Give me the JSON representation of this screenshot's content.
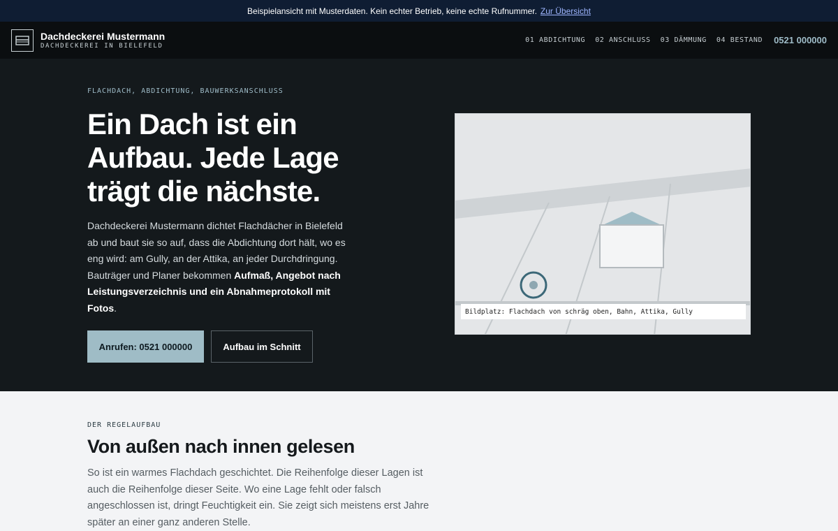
{
  "notice": {
    "text": "Beispielansicht mit Musterdaten. Kein echter Betrieb, keine echte Rufnummer.",
    "link": "Zur Übersicht"
  },
  "header": {
    "brand_name": "Dachdeckerei Mustermann",
    "brand_sub": "DACHDECKEREI IN BIELEFELD",
    "nav": [
      {
        "label": "01 ABDICHTUNG"
      },
      {
        "label": "02 ANSCHLUSS"
      },
      {
        "label": "03 DÄMMUNG"
      },
      {
        "label": "04 BESTAND"
      }
    ],
    "phone": "0521 000000"
  },
  "hero": {
    "eyebrow": "FLACHDACH, ABDICHTUNG, BAUWERKSANSCHLUSS",
    "title": "Ein Dach ist ein Aufbau. Jede Lage trägt die nächste.",
    "text_plain": "Dachdeckerei Mustermann dichtet Flachdächer in Bielefeld ab und baut sie so auf, dass die Abdichtung dort hält, wo es eng wird: am Gully, an der Attika, an jeder Durchdringung. Bauträger und Planer bekommen ",
    "text_strong": "Aufmaß, Angebot nach Leistungsverzeichnis und ein Abnahmeprotokoll mit Fotos",
    "text_end": ".",
    "btn_primary": "Anrufen: 0521 000000",
    "btn_secondary": "Aufbau im Schnitt",
    "figure_caption": "Bildplatz: Flachdach von schräg oben, Bahn, Attika, Gully"
  },
  "section": {
    "eyebrow": "DER REGELAUFBAU",
    "title": "Von außen nach innen gelesen",
    "text": "So ist ein warmes Flachdach geschichtet. Die Reihenfolge dieser Lagen ist auch die Reihenfolge dieser Seite. Wo eine Lage fehlt oder falsch angeschlossen ist, dringt Feuchtigkeit ein. Sie zeigt sich meistens erst Jahre später an einer ganz anderen Stelle."
  },
  "colors": {
    "notice_bg": "#0f1d33",
    "header_bg": "#0b0e10",
    "hero_bg": "#14191c",
    "accent": "#9fbcc6",
    "section_bg": "#f3f4f6"
  },
  "icons": {
    "logo": "roof-layers-icon",
    "gully": "drain-icon"
  }
}
